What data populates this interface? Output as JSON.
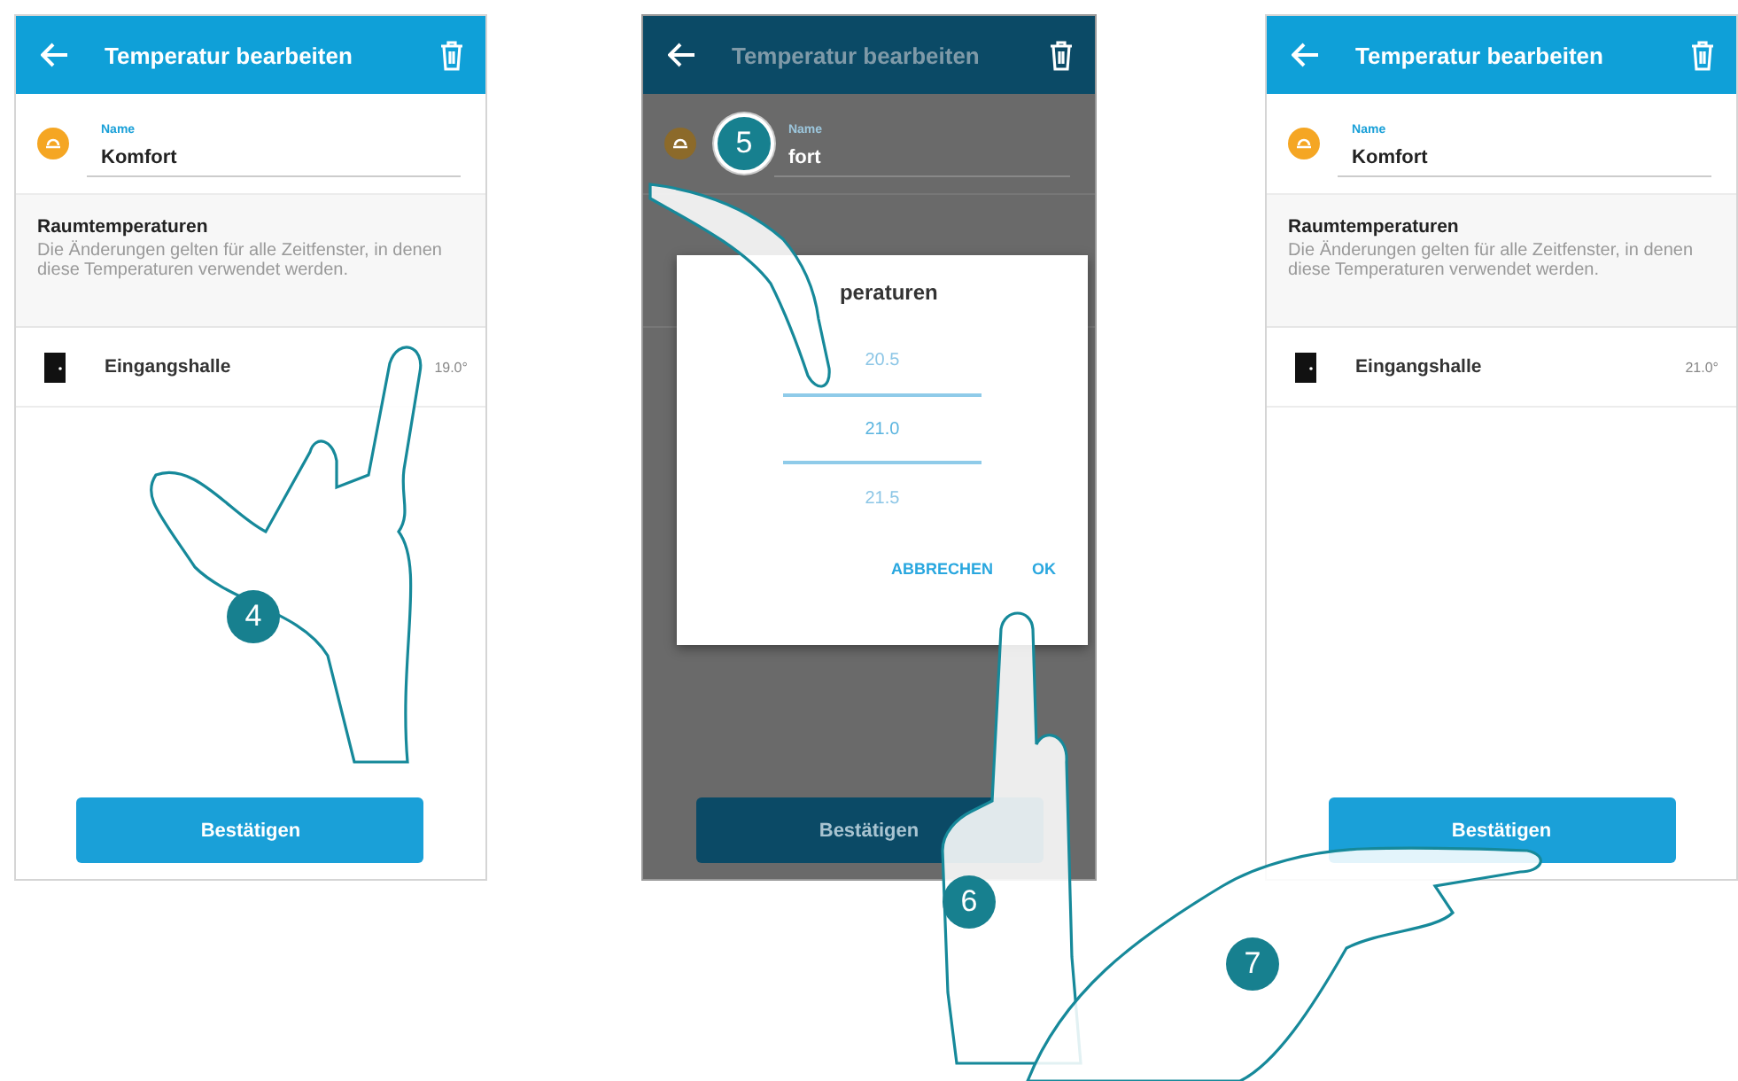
{
  "screens": [
    {
      "dimmed": false,
      "header": {
        "title": "Temperatur bearbeiten"
      },
      "name_field": {
        "label": "Name",
        "value": "Komfort"
      },
      "section": {
        "title": "Raumtemperaturen",
        "description": "Die Änderungen gelten für alle Zeitfenster, in denen diese Temperaturen verwendet werden."
      },
      "rooms": [
        {
          "name": "Eingangshalle",
          "value": "19.0°"
        }
      ],
      "confirm_button": "Bestätigen"
    },
    {
      "dimmed": true,
      "header": {
        "title": "Temperatur bearbeiten"
      },
      "name_field": {
        "label": "Name",
        "value": "fort"
      },
      "dialog": {
        "title": "peraturen",
        "options": [
          {
            "label": "20.5",
            "selected": false
          },
          {
            "label": "21.0",
            "selected": true
          },
          {
            "label": "21.5",
            "selected": false
          }
        ],
        "buttons": [
          "ABBRECHEN",
          "OK"
        ]
      },
      "confirm_button": "Bestätigen"
    },
    {
      "dimmed": false,
      "header": {
        "title": "Temperatur bearbeiten"
      },
      "name_field": {
        "label": "Name",
        "value": "Komfort"
      },
      "section": {
        "title": "Raumtemperaturen",
        "description": "Die Änderungen gelten für alle Zeitfenster, in denen diese Temperaturen verwendet werden."
      },
      "rooms": [
        {
          "name": "Eingangshalle",
          "value": "21.0°"
        }
      ],
      "confirm_button": "Bestätigen"
    }
  ],
  "steps": [
    {
      "label": "4",
      "kind": "plain"
    },
    {
      "label": "5",
      "kind": "ringed"
    },
    {
      "label": "6",
      "kind": "plain"
    },
    {
      "label": "7",
      "kind": "plain"
    }
  ]
}
